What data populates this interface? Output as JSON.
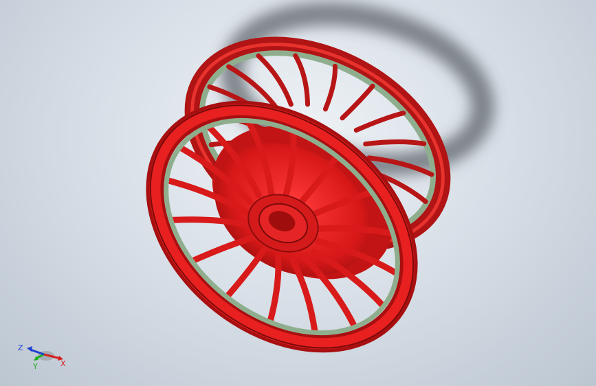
{
  "viewport": {
    "model_name": "",
    "colors": {
      "background_center": "#eef2f6",
      "background_edge": "#bcc6d1",
      "model_red": "#e01d1d",
      "model_dark_red": "#a30f10",
      "inner_rim_green": "#8fae8e",
      "shadow": "#4a4f55"
    }
  },
  "triad": {
    "x_label": "X",
    "y_label": "Y",
    "z_label": "Z",
    "x_color": "#d62020",
    "y_color": "#22b022",
    "z_color": "#2040d0"
  }
}
